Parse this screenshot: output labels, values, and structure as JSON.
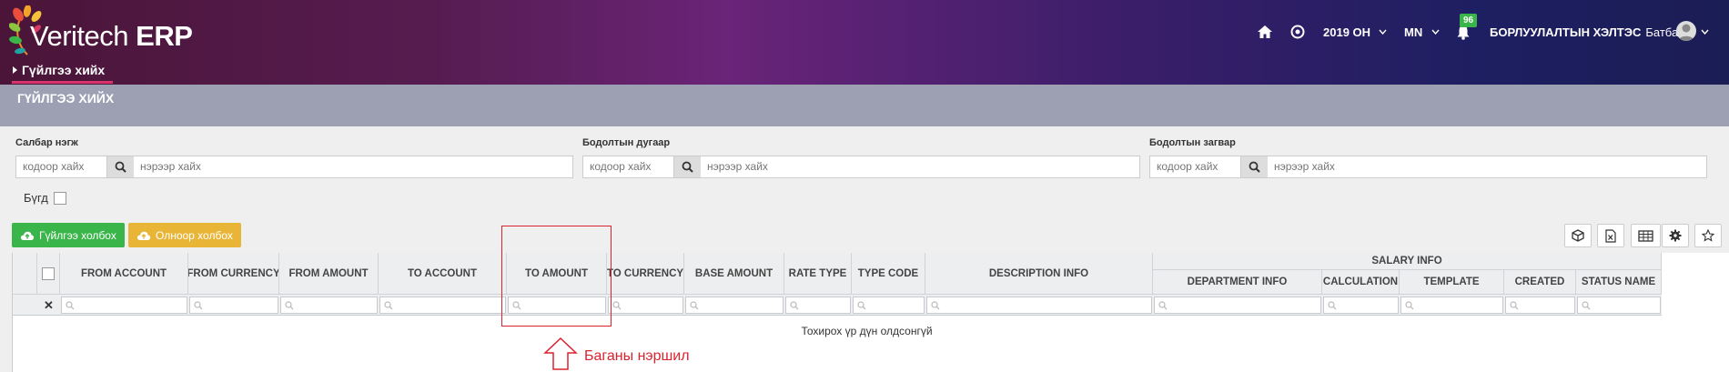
{
  "app": {
    "logo_text": "Veritech",
    "logo_bold": "ERP",
    "nav_tab": "Гүйлгээ хийх"
  },
  "header": {
    "year_label": "2019 ОН",
    "lang_label": "MN",
    "notifications_count": "96",
    "role_label": "БОРЛУУЛАЛТЫН ХЭЛТЭС",
    "user_name": "Батбаяр"
  },
  "page": {
    "title": "ГҮЙЛГЭЭ ХИЙХ"
  },
  "filters": [
    {
      "label": "Салбар нэгж",
      "code_placeholder": "кодоор хайх",
      "name_placeholder": "нэрээр хайх"
    },
    {
      "label": "Бодолтын дугаар",
      "code_placeholder": "кодоор хайх",
      "name_placeholder": "нэрээр хайх"
    },
    {
      "label": "Бодолтын загвар",
      "code_placeholder": "кодоор хайх",
      "name_placeholder": "нэрээр хайх"
    }
  ],
  "all_label": "Бүгд",
  "buttons": {
    "link_transaction": "Гүйлгээ холбох",
    "link_multiple": "Олноор холбох"
  },
  "grid": {
    "columns": [
      "FROM ACCOUNT",
      "FROM CURRENCY",
      "FROM AMOUNT",
      "TO ACCOUNT",
      "TO AMOUNT",
      "TO CURRENCY",
      "BASE AMOUNT",
      "RATE TYPE",
      "TYPE CODE",
      "DESCRIPTION INFO"
    ],
    "group_header": "SALARY INFO",
    "group_columns": [
      "DEPARTMENT INFO",
      "CALCULATION",
      "TEMPLATE",
      "CREATED",
      "STATUS NAME"
    ],
    "clear_filter": "✕",
    "empty_message": "Тохирох үр дүн олдсонгүй"
  },
  "annotation": {
    "text": "Баганы нэршил"
  },
  "colors": {
    "green": "#3ab54a",
    "yellow": "#e8b536",
    "annotation_red": "#d9232e",
    "band": "#9d9fb3"
  }
}
